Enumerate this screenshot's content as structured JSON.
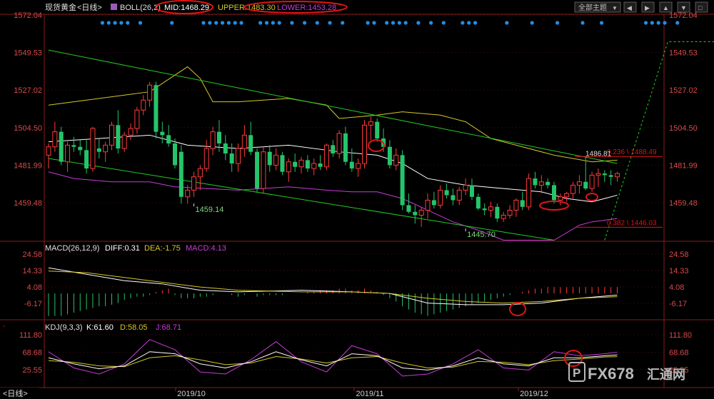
{
  "header": {
    "symbol": "现货黄金",
    "period": "<日线>",
    "indicator": "BOLL(26,2)",
    "mid_label": "MID:1468.29",
    "upper_label": "UPPER:1483.30",
    "lower_label": "LOWER:1453.28",
    "theme_button": "全部主题",
    "theme_arrow": "▼",
    "colors": {
      "mid": "#ffffff",
      "upper": "#d6c72a",
      "lower": "#c83cd8",
      "circle": "#e11414"
    }
  },
  "nav_buttons": [
    "◀",
    "▶",
    "▲",
    "▼",
    "□"
  ],
  "chart_data": {
    "type": "candlestick",
    "series_names": [
      "MID",
      "UPPER",
      "LOWER"
    ],
    "price_axis": {
      "ticks": [
        "1572.04",
        "1549.53",
        "1527.02",
        "1504.50",
        "1481.99",
        "1459.48"
      ],
      "ylim": [
        1430,
        1575
      ]
    },
    "x_ticks": [
      "2019/10",
      "2019/11",
      "2019/12"
    ],
    "candles": [
      {
        "o": 1488,
        "h": 1495,
        "l": 1480,
        "c": 1493
      },
      {
        "o": 1493,
        "h": 1508,
        "l": 1490,
        "c": 1502
      },
      {
        "o": 1502,
        "h": 1505,
        "l": 1482,
        "c": 1484
      },
      {
        "o": 1484,
        "h": 1496,
        "l": 1478,
        "c": 1494
      },
      {
        "o": 1494,
        "h": 1499,
        "l": 1490,
        "c": 1493
      },
      {
        "o": 1493,
        "h": 1497,
        "l": 1488,
        "c": 1491
      },
      {
        "o": 1491,
        "h": 1497,
        "l": 1477,
        "c": 1480
      },
      {
        "o": 1480,
        "h": 1505,
        "l": 1478,
        "c": 1504
      },
      {
        "o": 1492,
        "h": 1498,
        "l": 1486,
        "c": 1490
      },
      {
        "o": 1490,
        "h": 1496,
        "l": 1484,
        "c": 1494
      },
      {
        "o": 1494,
        "h": 1508,
        "l": 1491,
        "c": 1506
      },
      {
        "o": 1506,
        "h": 1515,
        "l": 1489,
        "c": 1492
      },
      {
        "o": 1492,
        "h": 1502,
        "l": 1490,
        "c": 1500
      },
      {
        "o": 1500,
        "h": 1507,
        "l": 1497,
        "c": 1504
      },
      {
        "o": 1504,
        "h": 1517,
        "l": 1501,
        "c": 1515
      },
      {
        "o": 1515,
        "h": 1524,
        "l": 1512,
        "c": 1521
      },
      {
        "o": 1521,
        "h": 1532,
        "l": 1517,
        "c": 1530
      },
      {
        "o": 1530,
        "h": 1532,
        "l": 1498,
        "c": 1502
      },
      {
        "o": 1502,
        "h": 1508,
        "l": 1495,
        "c": 1500
      },
      {
        "o": 1500,
        "h": 1506,
        "l": 1493,
        "c": 1495
      },
      {
        "o": 1495,
        "h": 1498,
        "l": 1480,
        "c": 1482
      },
      {
        "o": 1490,
        "h": 1494,
        "l": 1459,
        "c": 1463
      },
      {
        "o": 1463,
        "h": 1470,
        "l": 1459,
        "c": 1467
      },
      {
        "o": 1467,
        "h": 1478,
        "l": 1463,
        "c": 1475
      },
      {
        "o": 1475,
        "h": 1482,
        "l": 1467,
        "c": 1480
      },
      {
        "o": 1480,
        "h": 1497,
        "l": 1478,
        "c": 1492
      },
      {
        "o": 1492,
        "h": 1505,
        "l": 1488,
        "c": 1502
      },
      {
        "o": 1502,
        "h": 1509,
        "l": 1490,
        "c": 1495
      },
      {
        "o": 1495,
        "h": 1500,
        "l": 1485,
        "c": 1489
      },
      {
        "o": 1489,
        "h": 1495,
        "l": 1478,
        "c": 1483
      },
      {
        "o": 1483,
        "h": 1495,
        "l": 1478,
        "c": 1492
      },
      {
        "o": 1492,
        "h": 1506,
        "l": 1487,
        "c": 1500
      },
      {
        "o": 1500,
        "h": 1508,
        "l": 1488,
        "c": 1490
      },
      {
        "o": 1490,
        "h": 1492,
        "l": 1466,
        "c": 1468
      },
      {
        "o": 1468,
        "h": 1493,
        "l": 1465,
        "c": 1490
      },
      {
        "o": 1490,
        "h": 1494,
        "l": 1478,
        "c": 1482
      },
      {
        "o": 1482,
        "h": 1492,
        "l": 1479,
        "c": 1488
      },
      {
        "o": 1488,
        "h": 1490,
        "l": 1476,
        "c": 1478
      },
      {
        "o": 1478,
        "h": 1486,
        "l": 1472,
        "c": 1484
      },
      {
        "o": 1484,
        "h": 1489,
        "l": 1478,
        "c": 1481
      },
      {
        "o": 1481,
        "h": 1487,
        "l": 1477,
        "c": 1485
      },
      {
        "o": 1485,
        "h": 1488,
        "l": 1478,
        "c": 1480
      },
      {
        "o": 1480,
        "h": 1486,
        "l": 1476,
        "c": 1483
      },
      {
        "o": 1483,
        "h": 1488,
        "l": 1479,
        "c": 1481
      },
      {
        "o": 1481,
        "h": 1495,
        "l": 1479,
        "c": 1494
      },
      {
        "o": 1494,
        "h": 1497,
        "l": 1487,
        "c": 1489
      },
      {
        "o": 1489,
        "h": 1503,
        "l": 1486,
        "c": 1501
      },
      {
        "o": 1501,
        "h": 1505,
        "l": 1482,
        "c": 1484
      },
      {
        "o": 1484,
        "h": 1492,
        "l": 1478,
        "c": 1480
      },
      {
        "o": 1480,
        "h": 1486,
        "l": 1475,
        "c": 1483
      },
      {
        "o": 1483,
        "h": 1509,
        "l": 1480,
        "c": 1506
      },
      {
        "o": 1506,
        "h": 1511,
        "l": 1497,
        "c": 1508
      },
      {
        "o": 1508,
        "h": 1510,
        "l": 1496,
        "c": 1498
      },
      {
        "o": 1498,
        "h": 1504,
        "l": 1490,
        "c": 1493
      },
      {
        "o": 1493,
        "h": 1497,
        "l": 1480,
        "c": 1482
      },
      {
        "o": 1482,
        "h": 1492,
        "l": 1479,
        "c": 1488
      },
      {
        "o": 1488,
        "h": 1491,
        "l": 1455,
        "c": 1458
      },
      {
        "o": 1458,
        "h": 1465,
        "l": 1453,
        "c": 1454
      },
      {
        "o": 1454,
        "h": 1458,
        "l": 1447,
        "c": 1452
      },
      {
        "o": 1452,
        "h": 1457,
        "l": 1445,
        "c": 1455
      },
      {
        "o": 1455,
        "h": 1465,
        "l": 1450,
        "c": 1461
      },
      {
        "o": 1461,
        "h": 1466,
        "l": 1456,
        "c": 1458
      },
      {
        "o": 1458,
        "h": 1470,
        "l": 1456,
        "c": 1467
      },
      {
        "o": 1467,
        "h": 1471,
        "l": 1462,
        "c": 1464
      },
      {
        "o": 1464,
        "h": 1468,
        "l": 1458,
        "c": 1461
      },
      {
        "o": 1461,
        "h": 1469,
        "l": 1458,
        "c": 1467
      },
      {
        "o": 1467,
        "h": 1474,
        "l": 1464,
        "c": 1470
      },
      {
        "o": 1470,
        "h": 1474,
        "l": 1461,
        "c": 1463
      },
      {
        "o": 1463,
        "h": 1465,
        "l": 1455,
        "c": 1456
      },
      {
        "o": 1456,
        "h": 1459,
        "l": 1452,
        "c": 1455
      },
      {
        "o": 1455,
        "h": 1460,
        "l": 1451,
        "c": 1457
      },
      {
        "o": 1457,
        "h": 1459,
        "l": 1448,
        "c": 1450
      },
      {
        "o": 1450,
        "h": 1454,
        "l": 1448,
        "c": 1452
      },
      {
        "o": 1452,
        "h": 1458,
        "l": 1450,
        "c": 1455
      },
      {
        "o": 1455,
        "h": 1462,
        "l": 1451,
        "c": 1461
      },
      {
        "o": 1461,
        "h": 1466,
        "l": 1455,
        "c": 1457
      },
      {
        "o": 1457,
        "h": 1477,
        "l": 1455,
        "c": 1474
      },
      {
        "o": 1474,
        "h": 1478,
        "l": 1468,
        "c": 1470
      },
      {
        "o": 1470,
        "h": 1476,
        "l": 1465,
        "c": 1472
      },
      {
        "o": 1472,
        "h": 1474,
        "l": 1468,
        "c": 1470
      },
      {
        "o": 1470,
        "h": 1472,
        "l": 1459,
        "c": 1461
      },
      {
        "o": 1461,
        "h": 1465,
        "l": 1458,
        "c": 1463
      },
      {
        "o": 1463,
        "h": 1466,
        "l": 1460,
        "c": 1465
      },
      {
        "o": 1465,
        "h": 1472,
        "l": 1462,
        "c": 1470
      },
      {
        "o": 1470,
        "h": 1476,
        "l": 1465,
        "c": 1472
      },
      {
        "o": 1472,
        "h": 1487,
        "l": 1467,
        "c": 1468
      },
      {
        "o": 1468,
        "h": 1478,
        "l": 1466,
        "c": 1476
      },
      {
        "o": 1476,
        "h": 1480,
        "l": 1469,
        "c": 1477
      },
      {
        "o": 1477,
        "h": 1479,
        "l": 1472,
        "c": 1476
      },
      {
        "o": 1476,
        "h": 1479,
        "l": 1470,
        "c": 1475
      },
      {
        "o": 1475,
        "h": 1478,
        "l": 1472,
        "c": 1477
      }
    ],
    "mid": [
      [
        0,
        1496
      ],
      [
        8,
        1498
      ],
      [
        16,
        1500
      ],
      [
        22,
        1494
      ],
      [
        30,
        1492
      ],
      [
        38,
        1494
      ],
      [
        46,
        1490
      ],
      [
        52,
        1488
      ],
      [
        56,
        1483
      ],
      [
        60,
        1474
      ],
      [
        66,
        1470
      ],
      [
        72,
        1468
      ],
      [
        78,
        1466
      ],
      [
        82,
        1462
      ],
      [
        86,
        1460
      ],
      [
        88,
        1462
      ],
      [
        90,
        1464
      ]
    ],
    "upper": [
      [
        0,
        1518
      ],
      [
        6,
        1521
      ],
      [
        12,
        1524
      ],
      [
        16,
        1526
      ],
      [
        22,
        1541
      ],
      [
        24,
        1534
      ],
      [
        26,
        1520
      ],
      [
        30,
        1520
      ],
      [
        38,
        1522
      ],
      [
        44,
        1518
      ],
      [
        46,
        1510
      ],
      [
        52,
        1512
      ],
      [
        56,
        1514
      ],
      [
        62,
        1512
      ],
      [
        66,
        1508
      ],
      [
        70,
        1498
      ],
      [
        74,
        1494
      ],
      [
        80,
        1488
      ],
      [
        86,
        1484
      ],
      [
        90,
        1485
      ]
    ],
    "lower": [
      [
        0,
        1478
      ],
      [
        4,
        1474
      ],
      [
        10,
        1472
      ],
      [
        16,
        1472
      ],
      [
        20,
        1469
      ],
      [
        30,
        1467
      ],
      [
        38,
        1469
      ],
      [
        44,
        1467
      ],
      [
        48,
        1466
      ],
      [
        52,
        1466
      ],
      [
        56,
        1462
      ],
      [
        60,
        1455
      ],
      [
        64,
        1448
      ],
      [
        68,
        1443
      ],
      [
        72,
        1437
      ],
      [
        76,
        1437
      ],
      [
        80,
        1437
      ],
      [
        84,
        1446
      ],
      [
        86,
        1448
      ],
      [
        90,
        1450
      ]
    ],
    "channel_lines": [
      {
        "from": [
          0,
          1551
        ],
        "to": [
          90,
          1483
        ]
      },
      {
        "from": [
          0,
          1486
        ],
        "to": [
          80,
          1437
        ]
      }
    ],
    "projection_line": {
      "from": [
        88,
        1437
      ],
      "to": [
        98,
        1556
      ],
      "to_end": [
        112,
        1556
      ]
    },
    "annotations": [
      {
        "text": "1459.14",
        "bar": 23,
        "price": 1459
      },
      {
        "text": "1445.70",
        "bar": 66,
        "price": 1444
      },
      {
        "text": "1486.81",
        "bar": 100,
        "price": 1487
      }
    ],
    "fib": [
      {
        "label": "0.236 \\ 1488.49",
        "price": 1488.49
      },
      {
        "label": "0.382 \\ 1446.03",
        "price": 1446.03
      }
    ],
    "macd": {
      "label": "MACD(26,12,9)",
      "diff_label": "DIFF:0.31",
      "dea_label": "DEA:-1.75",
      "macd_label": "MACD:4.13",
      "ticks": [
        "24.58",
        "14.33",
        "4.08",
        "-6.17"
      ],
      "ylim": [
        -10,
        26
      ],
      "hist": [
        -14,
        -14,
        -14,
        -13,
        -12,
        -11,
        -10,
        -9,
        -8,
        -8,
        -7,
        -6,
        -4,
        -3,
        -2,
        -2,
        -1,
        1,
        2,
        3,
        -1,
        -3,
        -3,
        -3,
        -2,
        -2,
        -1,
        0,
        0,
        -1,
        -2,
        -1,
        0,
        -2,
        -1,
        -1,
        -1,
        -1,
        0,
        0,
        0,
        1,
        1,
        2,
        2,
        2,
        3,
        3,
        2,
        2,
        3,
        2,
        1,
        -1,
        -3,
        -5,
        -8,
        -10,
        -12,
        -13,
        -14,
        -13,
        -12,
        -11,
        -10,
        -9,
        -8,
        -7,
        -6,
        -5,
        -4,
        -3,
        -2,
        -1,
        0,
        1,
        2,
        3,
        3,
        4,
        4,
        4,
        4,
        4,
        4,
        4,
        4,
        4,
        4,
        4,
        4
      ],
      "diff": [
        [
          0,
          16
        ],
        [
          6,
          12
        ],
        [
          12,
          8
        ],
        [
          18,
          6
        ],
        [
          24,
          2
        ],
        [
          30,
          1
        ],
        [
          40,
          2
        ],
        [
          48,
          1
        ],
        [
          54,
          0
        ],
        [
          60,
          -6
        ],
        [
          66,
          -7
        ],
        [
          72,
          -7
        ],
        [
          78,
          -6
        ],
        [
          84,
          -3
        ],
        [
          90,
          -1
        ]
      ],
      "dea": [
        [
          0,
          14
        ],
        [
          6,
          13
        ],
        [
          12,
          10
        ],
        [
          18,
          7
        ],
        [
          24,
          4
        ],
        [
          30,
          2
        ],
        [
          40,
          1
        ],
        [
          48,
          1
        ],
        [
          54,
          0
        ],
        [
          60,
          -3
        ],
        [
          66,
          -5
        ],
        [
          72,
          -6
        ],
        [
          78,
          -5
        ],
        [
          84,
          -3
        ],
        [
          90,
          -2
        ]
      ]
    },
    "kdj": {
      "label": "KDJ(9,3,3)",
      "k_label": "K:61.60",
      "d_label": "D:58.05",
      "j_label": "J:68.71",
      "ticks": [
        "111.80",
        "68.68",
        "25.55"
      ],
      "ylim": [
        0,
        118
      ],
      "k": [
        [
          0,
          55
        ],
        [
          4,
          40
        ],
        [
          8,
          28
        ],
        [
          12,
          35
        ],
        [
          16,
          70
        ],
        [
          20,
          65
        ],
        [
          24,
          40
        ],
        [
          28,
          30
        ],
        [
          32,
          45
        ],
        [
          36,
          70
        ],
        [
          40,
          50
        ],
        [
          44,
          35
        ],
        [
          48,
          65
        ],
        [
          52,
          60
        ],
        [
          56,
          30
        ],
        [
          60,
          25
        ],
        [
          64,
          35
        ],
        [
          68,
          55
        ],
        [
          72,
          40
        ],
        [
          76,
          35
        ],
        [
          80,
          55
        ],
        [
          84,
          55
        ],
        [
          88,
          60
        ],
        [
          90,
          62
        ]
      ],
      "d": [
        [
          0,
          48
        ],
        [
          4,
          44
        ],
        [
          8,
          35
        ],
        [
          12,
          33
        ],
        [
          16,
          55
        ],
        [
          20,
          60
        ],
        [
          24,
          50
        ],
        [
          28,
          38
        ],
        [
          32,
          42
        ],
        [
          36,
          58
        ],
        [
          40,
          52
        ],
        [
          44,
          42
        ],
        [
          48,
          55
        ],
        [
          52,
          58
        ],
        [
          56,
          42
        ],
        [
          60,
          30
        ],
        [
          64,
          32
        ],
        [
          68,
          46
        ],
        [
          72,
          44
        ],
        [
          76,
          38
        ],
        [
          80,
          48
        ],
        [
          84,
          52
        ],
        [
          88,
          57
        ],
        [
          90,
          58
        ]
      ],
      "j": [
        [
          0,
          70
        ],
        [
          4,
          30
        ],
        [
          8,
          15
        ],
        [
          12,
          40
        ],
        [
          16,
          100
        ],
        [
          20,
          75
        ],
        [
          24,
          20
        ],
        [
          28,
          15
        ],
        [
          32,
          50
        ],
        [
          36,
          95
        ],
        [
          40,
          45
        ],
        [
          44,
          20
        ],
        [
          48,
          85
        ],
        [
          52,
          65
        ],
        [
          56,
          10
        ],
        [
          60,
          15
        ],
        [
          64,
          40
        ],
        [
          68,
          75
        ],
        [
          72,
          30
        ],
        [
          76,
          25
        ],
        [
          80,
          70
        ],
        [
          84,
          60
        ],
        [
          88,
          65
        ],
        [
          90,
          69
        ]
      ]
    }
  },
  "watermark": {
    "icon": "P",
    "text": "FX678",
    "cn_text": "汇通网"
  }
}
